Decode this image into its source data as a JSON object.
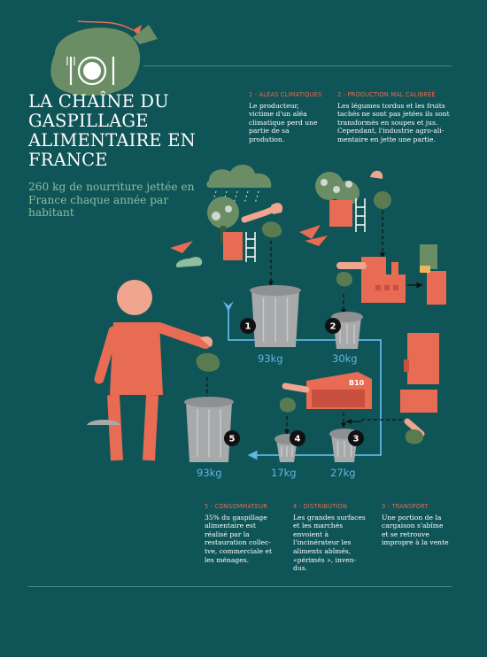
{
  "title": "LA CHAÎNE DU GASPILLAGE ALIMENTAIRE EN FRANCE",
  "subtitle": "260 kg de nourriture jettée en France chaque année par habitant",
  "steps": [
    {
      "heading": "1 - ALÉAS CLIMATIQUES",
      "text": "Le producteur,\nvictime d'un aléa\nclimatique perd une\npartie de sa\nprodution."
    },
    {
      "heading": "2 - PRODUCTION MAL CALIBRÉE",
      "text": "Les légumes tordus et les fruits\ntachés ne sont pas jetées ils sont\ntransformés en soupes et jus.\nCependant, l'industrie agro-ali-\nmentaire  en jette une partie."
    },
    {
      "heading": "3 - TRANSPORT",
      "text": "Une portion de la\ncargaison s'abîme\net se retrouve\nimpropre à la vente"
    },
    {
      "heading": "4 - DISTRIBUTION",
      "text": "Les grandes surfaces\net les marchés\nenvoient à\nl'incinérateur les\naliments abîmés,\n«périmés », inven-\ndus."
    },
    {
      "heading": "5 - CONSOMMATEUR",
      "text": "35% du gaspillage\nalimentaire est\nréalisé par la\nrestauration collec-\ntve, commerciale et\nles ménages."
    }
  ],
  "bins": [
    {
      "number": "1",
      "weight": "93kg"
    },
    {
      "number": "2",
      "weight": "30kg"
    },
    {
      "number": "3",
      "weight": "27kg"
    },
    {
      "number": "4",
      "weight": "17kg"
    },
    {
      "number": "5",
      "weight": "93kg"
    }
  ],
  "truck_label": "B10",
  "colors": {
    "background": "#0f5457",
    "accent_red": "#e86b53",
    "bin_grey": "#a7a9ab",
    "arrow_blue": "#5fb6e3",
    "bag_green": "#5a7b4f",
    "skin": "#f0a58f"
  }
}
